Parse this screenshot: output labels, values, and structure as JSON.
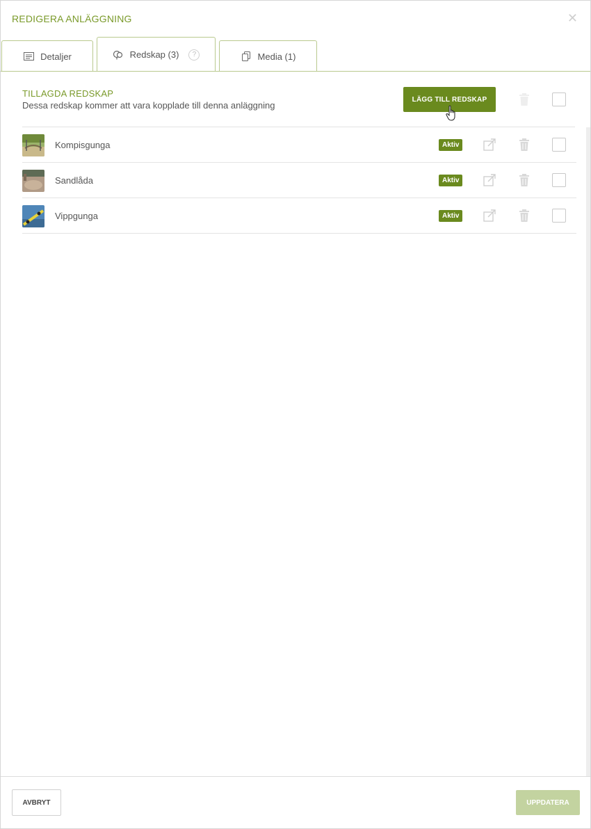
{
  "modal": {
    "title": "REDIGERA ANLÄGGNING",
    "close_icon": "close-icon"
  },
  "tabs": [
    {
      "label": "Detaljer",
      "icon": "details-list-icon",
      "active": false
    },
    {
      "label": "Redskap (3)",
      "icon": "equipment-icon",
      "active": true,
      "help_icon": "help-icon",
      "help_glyph": "?"
    },
    {
      "label": "Media (1)",
      "icon": "media-copy-icon",
      "active": false
    }
  ],
  "section": {
    "title": "TILLAGDA REDSKAP",
    "subtitle": "Dessa redskap kommer att vara kopplade till denna anläggning",
    "add_button_label": "LÄGG TILL REDSKAP"
  },
  "equipment": [
    {
      "name": "Kompisgunga",
      "status": "Aktiv"
    },
    {
      "name": "Sandlåda",
      "status": "Aktiv"
    },
    {
      "name": "Vippgunga",
      "status": "Aktiv"
    }
  ],
  "footer": {
    "cancel_label": "AVBRYT",
    "update_label": "UPPDATERA"
  },
  "colors": {
    "accent": "#6a8a1e",
    "title_green": "#7a9a2a",
    "disabled_green": "#c3d3a0"
  }
}
